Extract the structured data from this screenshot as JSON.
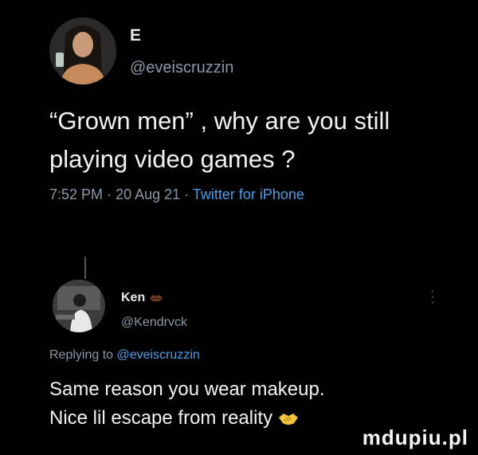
{
  "tweet": {
    "author_name": "E",
    "handle": "@eveiscruzzin",
    "text": "“Grown men” , why are you still playing video games ?",
    "time": "7:52 PM",
    "date": "20 Aug 21",
    "separator": "·",
    "client": "Twitter for iPhone"
  },
  "reply": {
    "author_name": "Ken",
    "handle": "@Kendrvck",
    "replying_prefix": "Replying to",
    "replying_mention": "@eveiscruzzin",
    "text_line1": "Same reason you wear makeup.",
    "text_line2": "Nice lil escape from reality"
  },
  "watermark": "mdupiu.pl",
  "colors": {
    "background": "#000000",
    "text": "#e7e9ea",
    "muted": "#8b98a5",
    "link": "#4f9fe8"
  }
}
